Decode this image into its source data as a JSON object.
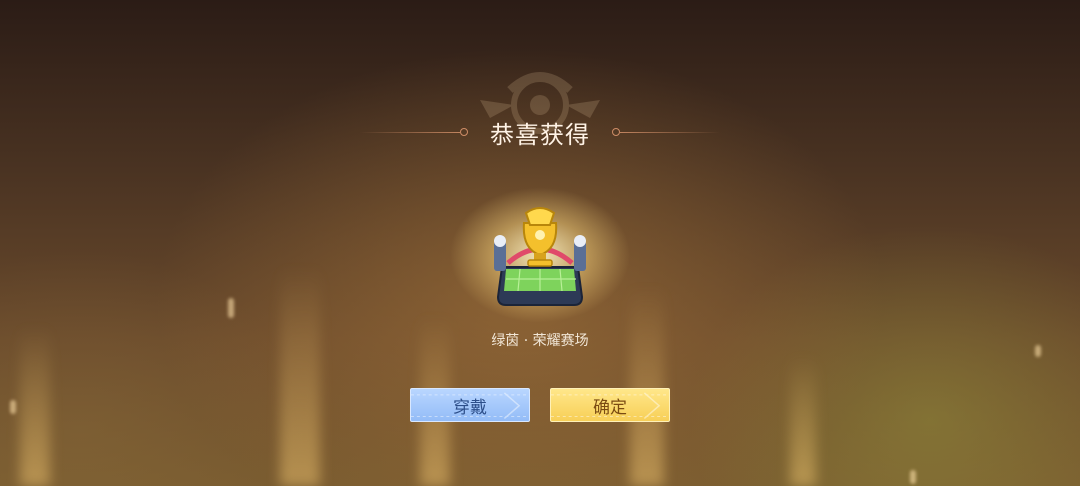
{
  "dialog": {
    "title": "恭喜获得",
    "reward_name": "绿茵 · 荣耀赛场",
    "reward_icon": "golden-trophy-stadium-icon"
  },
  "buttons": {
    "wear_label": "穿戴",
    "confirm_label": "确定"
  },
  "colors": {
    "title_text": "#fff3e6",
    "wear_button": "#a6c8fb",
    "confirm_button": "#fbdb70",
    "background": "#4a3322"
  }
}
